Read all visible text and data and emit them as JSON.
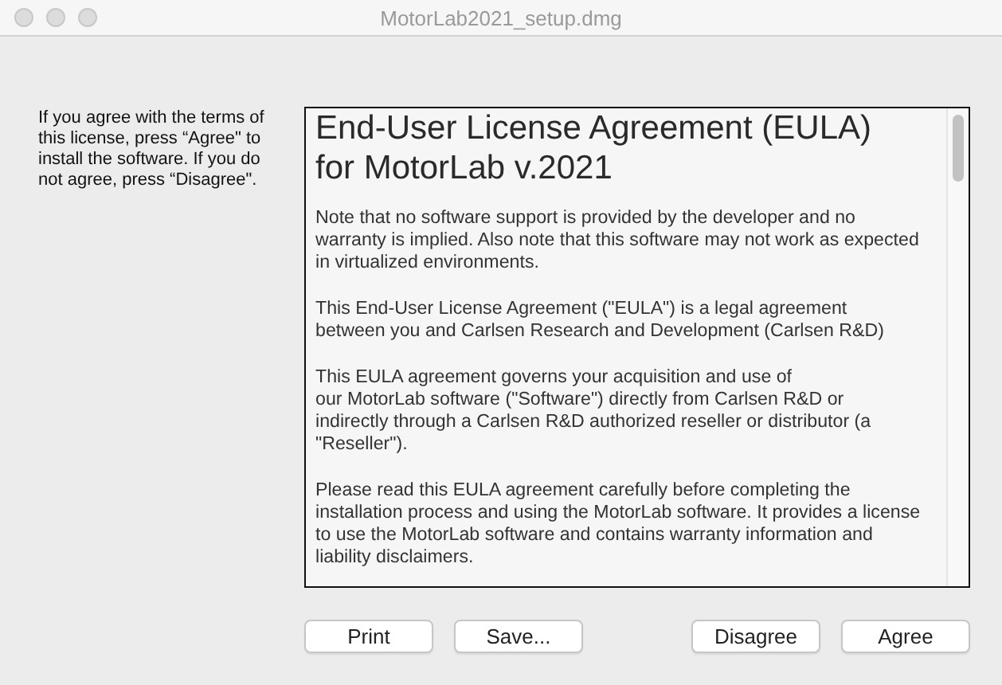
{
  "window": {
    "title": "MotorLab2021_setup.dmg"
  },
  "instructions": "If you agree with the terms of\nthis license, press “Agree\" to\ninstall the software. If you do\nnot agree, press “Disagree\".",
  "license": {
    "heading": "End-User License Agreement (EULA)\nfor MotorLab v.2021",
    "paragraphs": [
      "Note that no software support is provided by the developer and no\nwarranty is implied. Also note that this software may not work as expected\nin virtualized environments.",
      "This End-User License Agreement (\"EULA\") is a legal agreement\nbetween you and Carlsen Research and Development (Carlsen R&D)",
      "This EULA agreement governs your acquisition and use of\nour MotorLab software (\"Software\") directly from Carlsen R&D or\nindirectly through a Carlsen R&D authorized reseller or distributor (a\n\"Reseller\").",
      "Please read this EULA agreement carefully before completing the\ninstallation process and using the MotorLab software. It provides a license\nto use the MotorLab software and contains warranty information and\nliability disclaimers."
    ]
  },
  "buttons": {
    "left": [
      "Print",
      "Save..."
    ],
    "right": [
      "Disagree",
      "Agree"
    ]
  }
}
